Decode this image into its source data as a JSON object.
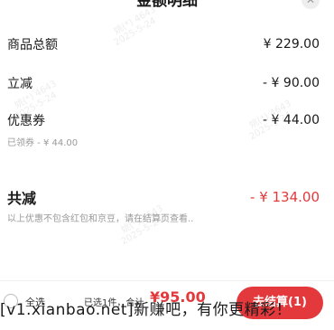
{
  "sheet": {
    "title": "金额明细",
    "close_icon": "close-icon"
  },
  "rows": {
    "goods_total": {
      "label": "商品总额",
      "amount": "¥ 229.00"
    },
    "instant_discount": {
      "label": "立减",
      "amount": "- ¥ 90.00"
    },
    "coupon": {
      "label": "优惠券",
      "amount": "- ¥ 44.00",
      "sub": "已领券 - ¥ 44.00"
    }
  },
  "total_discount": {
    "label": "共减",
    "amount": "- ¥ 134.00",
    "note": "以上优惠不包含红包和京豆，请在结算页查看.."
  },
  "bottom_bar": {
    "select_all": "全选",
    "selected_info": "已选1件，合计",
    "grand_total": "¥95.00",
    "checkout_label": "去结算(1)"
  },
  "watermark": {
    "lines": [
      "姚(*) 4643",
      "2025-5-24"
    ]
  },
  "overlay_caption": "[v1.xianbao.net]新赚吧，有你更精彩！",
  "colors": {
    "accent": "#e4393c",
    "muted": "#999999"
  }
}
